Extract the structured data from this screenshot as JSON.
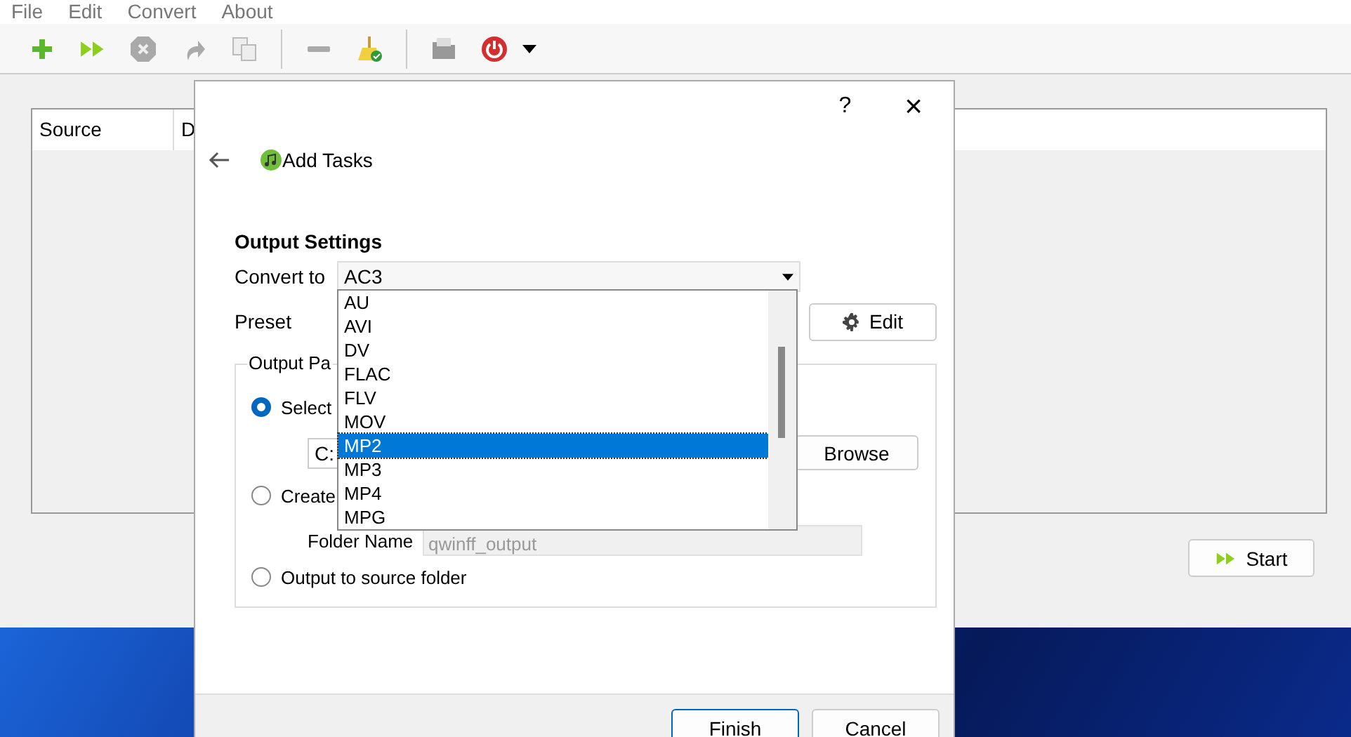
{
  "menu": [
    "File",
    "Edit",
    "Convert",
    "About"
  ],
  "table": {
    "columns": [
      "Source",
      "D"
    ]
  },
  "start_button": "Start",
  "dialog": {
    "help": "?",
    "close": "×",
    "title": "Add Tasks",
    "section": "Output Settings",
    "convert_label": "Convert to",
    "convert_value": "AC3",
    "preset_label": "Preset",
    "edit_button": "Edit",
    "group_title": "Output Pa",
    "options": [
      {
        "label": "Select",
        "selected": true
      },
      {
        "label": "Create",
        "selected": false
      },
      {
        "label": "Output to source folder",
        "selected": false
      }
    ],
    "path_value": "C:",
    "browse_button": "Browse",
    "folder_label": "Folder Name",
    "folder_value": "qwinff_output",
    "buttons": [
      "Finish",
      "Cancel"
    ]
  },
  "dropdown": [
    {
      "label": "AU",
      "selected": false
    },
    {
      "label": "AVI",
      "selected": false
    },
    {
      "label": "DV",
      "selected": false
    },
    {
      "label": "FLAC",
      "selected": false
    },
    {
      "label": "FLV",
      "selected": false
    },
    {
      "label": "MOV",
      "selected": false
    },
    {
      "label": "MP2",
      "selected": true
    },
    {
      "label": "MP3",
      "selected": false
    },
    {
      "label": "MP4",
      "selected": false
    },
    {
      "label": "MPG",
      "selected": false
    }
  ]
}
